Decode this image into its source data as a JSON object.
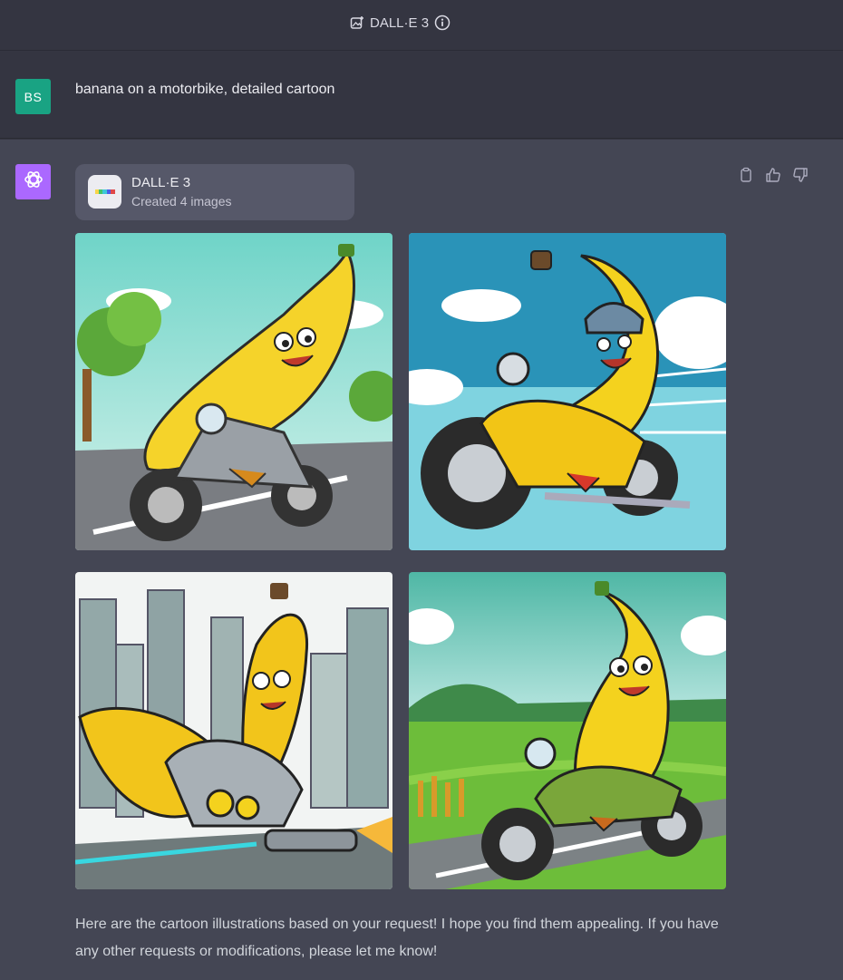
{
  "header": {
    "model_label": "DALL·E 3",
    "model_icon": "image-plus-icon",
    "info_icon": "info-icon"
  },
  "user_message": {
    "avatar_initials": "BS",
    "avatar_color": "#19a383",
    "text": "banana on a motorbike, detailed cartoon"
  },
  "assistant": {
    "avatar_color": "#ab68ff",
    "tool": {
      "title": "DALL·E 3",
      "subtitle": "Created 4 images"
    },
    "actions": [
      "copy-icon",
      "thumbs-up-icon",
      "thumbs-down-icon"
    ],
    "images": [
      "cartoon-banana-riding-motorbike-on-road-with-trees",
      "cartoon-banana-with-helmet-speeding-on-motorbike",
      "cartoon-banana-on-futuristic-banana-bike-in-city",
      "cartoon-banana-on-green-motorbike-in-countryside"
    ],
    "reply": "Here are the cartoon illustrations based on your request! I hope you find them appealing. If you have any other requests or modifications, please let me know!"
  }
}
